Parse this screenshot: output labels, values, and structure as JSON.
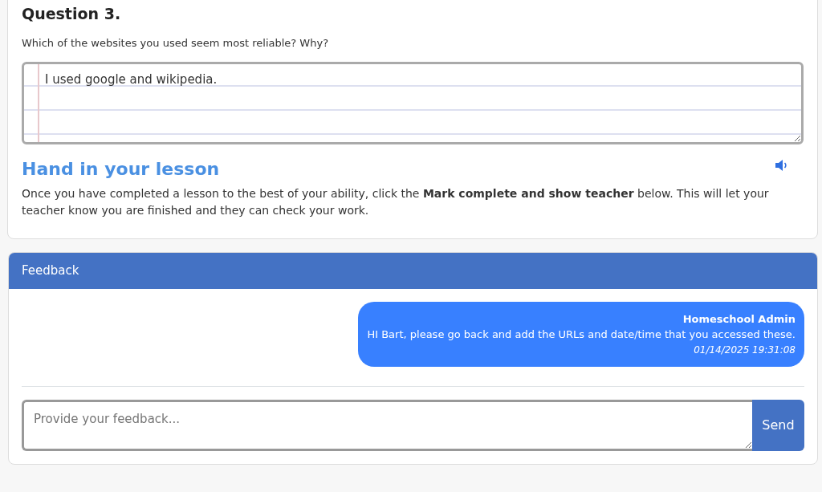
{
  "question": {
    "title": "Question 3.",
    "prompt": "Which of the websites you used seem most reliable? Why?",
    "answer": "I used google and wikipedia."
  },
  "hand_in": {
    "heading": "Hand in your lesson",
    "text": "Once you have completed a lesson to the best of your ability, click the **Mark complete and show teacher** below. This will let your teacher know you are finished and they can check your work."
  },
  "feedback": {
    "header": "Feedback",
    "messages": [
      {
        "author": "Homeschool Admin",
        "text": "HI Bart, please go back and add the URLs and date/time that you accessed these.",
        "time": "01/14/2025 19:31:08"
      }
    ],
    "input": {
      "placeholder": "Provide your feedback..."
    },
    "send": "Send"
  }
}
